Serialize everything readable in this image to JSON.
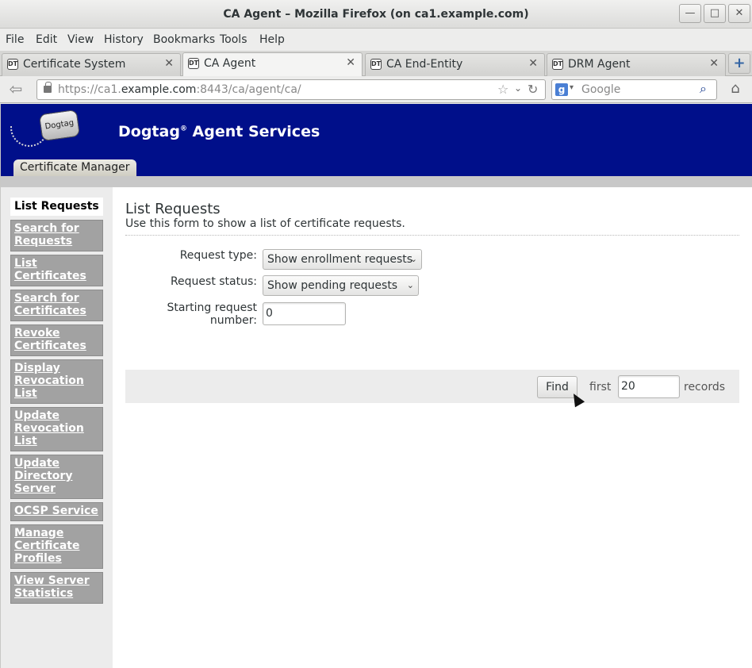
{
  "window": {
    "title": "CA Agent – Mozilla Firefox (on ca1.example.com)",
    "minimize": "—",
    "maximize": "□",
    "close": "✕"
  },
  "menu": [
    "File",
    "Edit",
    "View",
    "History",
    "Bookmarks",
    "Tools",
    "Help"
  ],
  "tabs": [
    {
      "label": "Certificate System",
      "icon": "DT",
      "close": "✕"
    },
    {
      "label": "CA Agent",
      "icon": "DT",
      "close": "✕"
    },
    {
      "label": "CA End-Entity",
      "icon": "DT",
      "close": "✕"
    },
    {
      "label": "DRM Agent",
      "icon": "DT",
      "close": "✕"
    }
  ],
  "new_tab": "+",
  "nav": {
    "back": "⇦",
    "url_prefix": "https://ca1.",
    "url_host": "example.com",
    "url_rest": ":8443/ca/agent/ca/",
    "bookmark_star": "☆",
    "url_dropdown": "⌄",
    "reload": "↻",
    "search_engine": "g",
    "search_dropdown": "▾",
    "search_placeholder": "Google",
    "search_magnifier": "⌕",
    "home": "⌂"
  },
  "banner": {
    "logo_text": "Dogtag",
    "brand_name": "Dogtag",
    "brand_reg": "®",
    "brand_suffix": " Agent Services",
    "section_tab": "Certificate Manager"
  },
  "sidebar": {
    "items": [
      {
        "label": "List Requests",
        "active": true
      },
      {
        "label": "Search for Requests"
      },
      {
        "label": "List Certificates"
      },
      {
        "label": "Search for Certificates"
      },
      {
        "label": "Revoke Certificates"
      },
      {
        "label": "Display Revocation List"
      },
      {
        "label": "Update Revocation List"
      },
      {
        "label": "Update Directory Server"
      },
      {
        "label": "OCSP Service"
      },
      {
        "label": "Manage Certificate Profiles"
      },
      {
        "label": "View Server Statistics"
      }
    ]
  },
  "main": {
    "title": "List Requests",
    "description": "Use this form to show a list of certificate requests.",
    "request_type_label": "Request type:",
    "request_type_value": "Show enrollment requests",
    "request_status_label": "Request status:",
    "request_status_value": "Show pending requests",
    "start_label": "Starting request number:",
    "start_value": "0",
    "find_button": "Find",
    "first_label": "first",
    "count_value": "20",
    "records_label": "records"
  },
  "colors": {
    "banner": "#000f8a",
    "sidebar_item": "#a2a2a2"
  }
}
